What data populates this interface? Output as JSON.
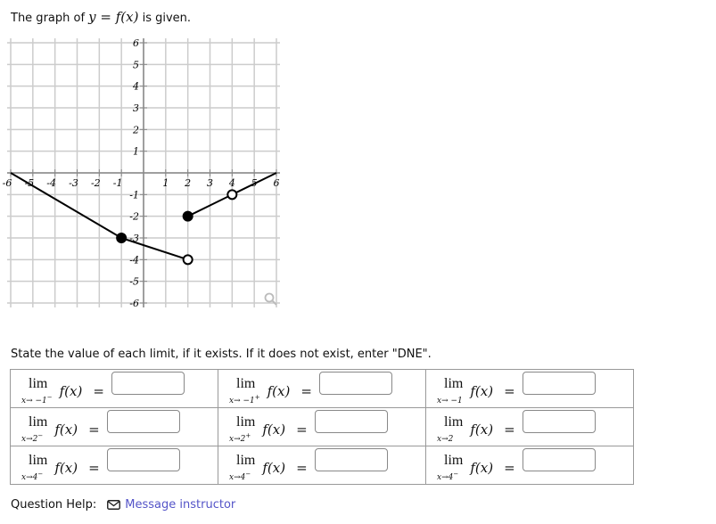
{
  "prompt": {
    "before": "The graph of",
    "math": "y = f(x)",
    "after": "is given."
  },
  "chart_data": {
    "type": "line",
    "xlim": [
      -6,
      6
    ],
    "ylim": [
      -6,
      6
    ],
    "grid": true,
    "xticks": [
      "-6",
      "-5",
      "-4",
      "-3",
      "-2",
      "-1",
      "1",
      "2",
      "3",
      "4",
      "5",
      "6"
    ],
    "yticks": [
      "6",
      "5",
      "4",
      "3",
      "2",
      "1",
      "-1",
      "-2",
      "-3",
      "-4",
      "-5",
      "-6"
    ],
    "segments": [
      {
        "from": [
          -6,
          0
        ],
        "to": [
          -1,
          -3
        ]
      },
      {
        "from": [
          -1,
          -3
        ],
        "to": [
          2,
          -4
        ]
      },
      {
        "from": [
          2,
          -2
        ],
        "to": [
          4,
          -1
        ]
      },
      {
        "from": [
          4,
          -1
        ],
        "to": [
          6,
          0
        ]
      }
    ],
    "points": [
      {
        "x": -1,
        "y": -3,
        "filled": true
      },
      {
        "x": 2,
        "y": -4,
        "filled": false
      },
      {
        "x": 2,
        "y": -2,
        "filled": true
      },
      {
        "x": 4,
        "y": -1,
        "filled": false
      }
    ],
    "zoom_icon": "magnifier-icon"
  },
  "instructions": "State the value of each limit, if it exists. If it does not exist, enter \"DNE\".",
  "limits": [
    [
      {
        "approach": "x→ −1",
        "side": "−",
        "value": ""
      },
      {
        "approach": "x→ −1",
        "side": "+",
        "value": ""
      },
      {
        "approach": "x→ −1",
        "side": "",
        "value": ""
      }
    ],
    [
      {
        "approach": "x→2",
        "side": "−",
        "value": ""
      },
      {
        "approach": "x→2",
        "side": "+",
        "value": ""
      },
      {
        "approach": "x→2",
        "side": "",
        "value": ""
      }
    ],
    [
      {
        "approach": "x→4",
        "side": "−",
        "value": ""
      },
      {
        "approach": "x→4",
        "side": "−",
        "value": ""
      },
      {
        "approach": "x→4",
        "side": "−",
        "value": ""
      }
    ]
  ],
  "lim_word": "lim",
  "fx": "f(x)",
  "eq": "=",
  "help": {
    "label": "Question Help:",
    "link": "Message instructor",
    "icon": "envelope-icon"
  },
  "colors": {
    "link": "#5454c8",
    "grid": "#cccccc",
    "curve": "#000000"
  }
}
